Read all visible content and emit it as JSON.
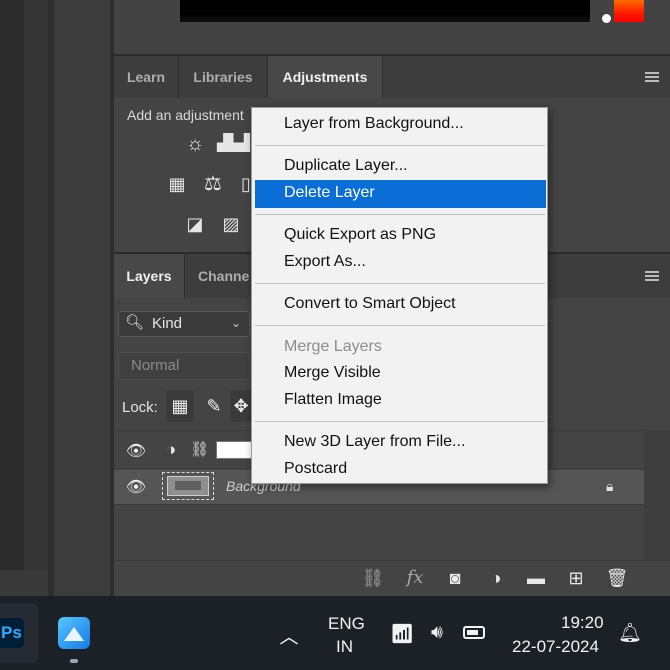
{
  "adjustments_panel": {
    "tabs": [
      "Learn",
      "Libraries",
      "Adjustments"
    ],
    "active_tab": "Adjustments",
    "hint_text": "Add an adjustment"
  },
  "layers_panel": {
    "tabs": [
      "Layers",
      "Channe"
    ],
    "filter_kind": "Kind",
    "blend_mode": "Normal",
    "lock_label": "Lock:",
    "layers": [
      {
        "name": "",
        "type": "adjustment"
      },
      {
        "name": "Background",
        "locked": true,
        "selected": true
      }
    ]
  },
  "context_menu": {
    "items": [
      {
        "label": "Layer from Background...",
        "enabled": true
      },
      {
        "label": "Duplicate Layer...",
        "enabled": true
      },
      {
        "label": "Delete Layer",
        "enabled": true,
        "highlighted": true
      },
      {
        "label": "Quick Export as PNG",
        "enabled": true
      },
      {
        "label": "Export As...",
        "enabled": true
      },
      {
        "label": "Convert to Smart Object",
        "enabled": true
      },
      {
        "label": "Merge Layers",
        "enabled": false
      },
      {
        "label": "Merge Visible",
        "enabled": true
      },
      {
        "label": "Flatten Image",
        "enabled": true
      },
      {
        "label": "New 3D Layer from File...",
        "enabled": true
      },
      {
        "label": "Postcard",
        "enabled": true
      }
    ]
  },
  "taskbar": {
    "ps_label": "Ps",
    "language": "ENG",
    "region": "IN",
    "time": "19:20",
    "date": "22-07-2024"
  },
  "colors": {
    "menu_highlight": "#0a6ed6",
    "panel_bg": "#444444",
    "taskbar_bg": "#1c2027"
  }
}
